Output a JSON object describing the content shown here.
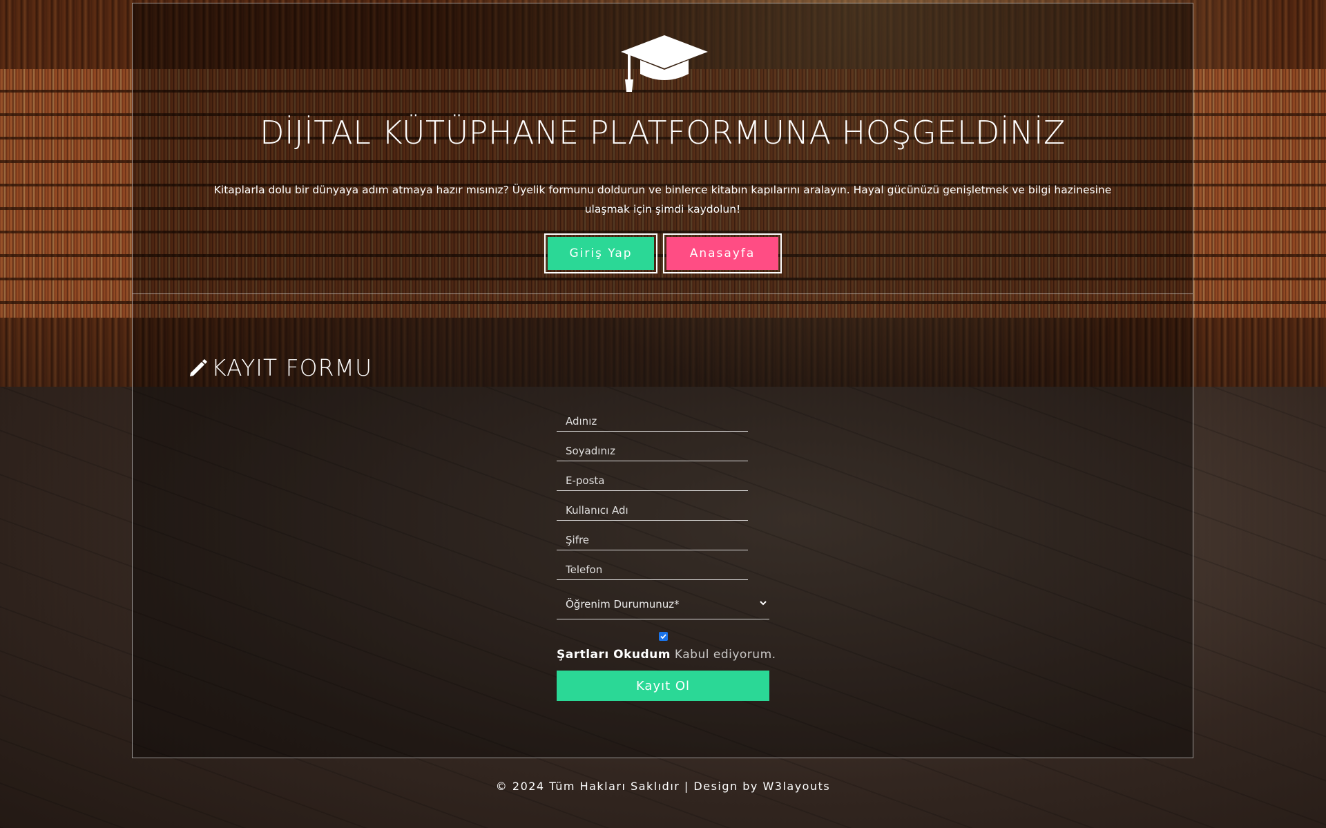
{
  "header": {
    "icon": "graduation-cap-icon",
    "title": "DİJİTAL KÜTÜPHANE PLATFORMUNA HOŞGELDİNİZ",
    "intro": "Kitaplarla dolu bir dünyaya adım atmaya hazır mısınız? Üyelik formunu doldurun ve binlerce kitabın kapılarını aralayın. Hayal gücünüzü genişletmek ve bilgi hazinesine ulaşmak için şimdi kaydolun!",
    "login_label": "Giriş Yap",
    "home_label": "Anasayfa"
  },
  "form": {
    "heading": "KAYIT FORMU",
    "heading_icon": "pencil-icon",
    "fields": {
      "first_name_placeholder": "Adınız",
      "last_name_placeholder": "Soyadınız",
      "email_placeholder": "E-posta",
      "username_placeholder": "Kullanıcı Adı",
      "password_placeholder": "Şifre",
      "phone_placeholder": "Telefon"
    },
    "education_select": "Öğrenim Durumunuz*",
    "terms_checked": true,
    "terms_bold": "Şartları Okudum",
    "terms_rest": "Kabul ediyorum.",
    "submit_label": "Kayıt Ol"
  },
  "colors": {
    "accent_green": "#2bd896",
    "accent_pink": "#ff4d84",
    "checkbox_blue": "#1a73e8"
  },
  "footer": {
    "text": "© 2024 Tüm Hakları Saklıdır | Design by W3layouts"
  }
}
